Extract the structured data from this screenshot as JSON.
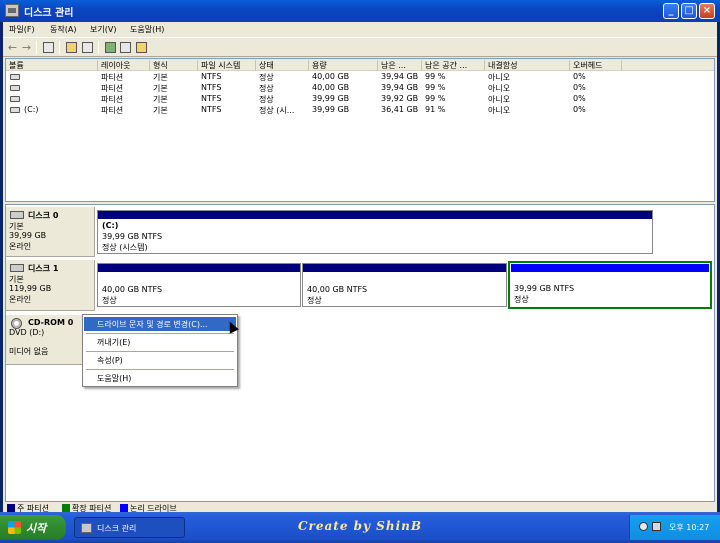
{
  "window": {
    "title": "디스크 관리",
    "controls": {
      "minimize": "_",
      "maximize": "□",
      "close": "×"
    }
  },
  "menubar": [
    "파일(F)",
    "동작(A)",
    "보기(V)",
    "도움말(H)"
  ],
  "toolbar": {
    "icons": [
      "back-icon",
      "forward-icon",
      "console-tree-icon",
      "properties-icon",
      "help-icon",
      "connect-drive-icon",
      "settings-icon",
      "list-view-icon"
    ]
  },
  "volumes": {
    "columns": [
      "볼륨",
      "레이아웃",
      "형식",
      "파일 시스템",
      "상태",
      "용량",
      "남은 ...",
      "남은 공간 ...",
      "내결함성",
      "오버헤드"
    ],
    "rows": [
      {
        "volume": "",
        "layout": "파티션",
        "type": "기본",
        "fs": "NTFS",
        "status": "정상",
        "capacity": "40,00 GB",
        "free": "39,94 GB",
        "free_pct": "99 %",
        "fault": "아니오",
        "overhead": "0%"
      },
      {
        "volume": "",
        "layout": "파티션",
        "type": "기본",
        "fs": "NTFS",
        "status": "정상",
        "capacity": "40,00 GB",
        "free": "39,94 GB",
        "free_pct": "99 %",
        "fault": "아니오",
        "overhead": "0%"
      },
      {
        "volume": "",
        "layout": "파티션",
        "type": "기본",
        "fs": "NTFS",
        "status": "정상",
        "capacity": "39,99 GB",
        "free": "39,92 GB",
        "free_pct": "99 %",
        "fault": "아니오",
        "overhead": "0%"
      },
      {
        "volume": "(C:)",
        "layout": "파티션",
        "type": "기본",
        "fs": "NTFS",
        "status": "정상 (시...",
        "capacity": "39,99 GB",
        "free": "36,41 GB",
        "free_pct": "91 %",
        "fault": "아니오",
        "overhead": "0%"
      }
    ]
  },
  "disks": [
    {
      "name": "디스크 0",
      "type": "기본",
      "size": "39,99 GB",
      "state": "온라인",
      "partitions": [
        {
          "label": "(C:)",
          "size": "39,99 GB NTFS",
          "status": "정상 (시스템)",
          "kind": "primary"
        }
      ]
    },
    {
      "name": "디스크 1",
      "type": "기본",
      "size": "119,99 GB",
      "state": "온라인",
      "partitions": [
        {
          "label": "",
          "size": "40,00 GB NTFS",
          "status": "정상",
          "kind": "primary"
        },
        {
          "label": "",
          "size": "40,00 GB NTFS",
          "status": "정상",
          "kind": "primary"
        },
        {
          "label": "",
          "size": "39,99 GB NTFS",
          "status": "정상",
          "kind": "logical"
        }
      ]
    },
    {
      "name": "CD-ROM 0",
      "type": "DVD (D:)",
      "size": "",
      "state": "미디어 없음",
      "partitions": []
    }
  ],
  "legend": [
    {
      "label": "주 파티션",
      "color": "#00007f"
    },
    {
      "label": "확장 파티션",
      "color": "#008000"
    },
    {
      "label": "논리 드라이브",
      "color": "#0000ff"
    }
  ],
  "context_menu": {
    "items": [
      "드라이브 문자 및 경로 변경(C)...",
      "꺼내기(E)",
      "속성(P)",
      "도움말(H)"
    ],
    "selected": 0
  },
  "taskbar": {
    "start_label": "시작",
    "task_label": "디스크 관리",
    "brand": "Create by ShinB",
    "clock": "오후 10:27"
  },
  "colors": {
    "titlebar": "#0b4ec9",
    "primary_partition": "#00007f",
    "extended_partition": "#008000",
    "logical_drive": "#0000ff",
    "menu_selection": "#316ac5",
    "taskbar": "#245edb"
  }
}
